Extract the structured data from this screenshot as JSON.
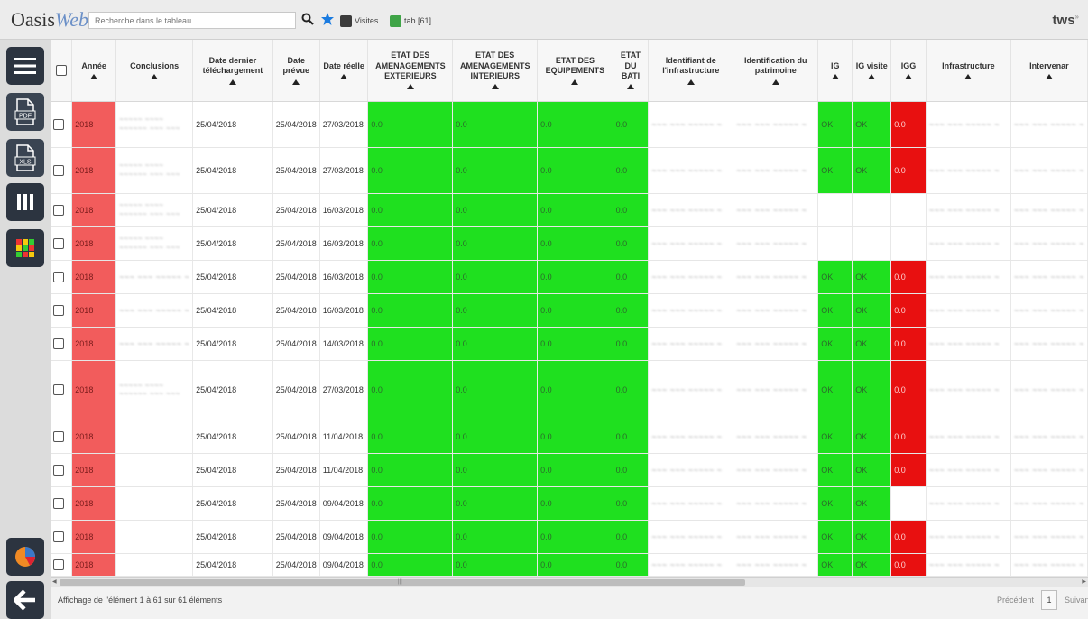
{
  "app": {
    "name_main": "Oasis",
    "name_accent": "Web",
    "user": "tws",
    "user_close": "»"
  },
  "search": {
    "placeholder": "Recherche dans le tableau..."
  },
  "toolbar": {
    "visits_label": "Visites",
    "tab_label": "tab [61]"
  },
  "colors": {
    "red": "#f25c5c",
    "green": "#1fe01f",
    "dark_red": "#e81010"
  },
  "table": {
    "headers": [
      {
        "key": "annee",
        "label": "Année"
      },
      {
        "key": "conclusions",
        "label": "Conclusions"
      },
      {
        "key": "date_dl",
        "label": "Date dernier téléchargement"
      },
      {
        "key": "date_prevue",
        "label": "Date prévue"
      },
      {
        "key": "date_reelle",
        "label": "Date réelle"
      },
      {
        "key": "etat_ext",
        "label": "ETAT DES AMENAGEMENTS EXTERIEURS"
      },
      {
        "key": "etat_int",
        "label": "ETAT DES AMENAGEMENTS INTERIEURS"
      },
      {
        "key": "etat_equip",
        "label": "ETAT DES EQUIPEMENTS"
      },
      {
        "key": "etat_bati",
        "label": "ETAT DU BATI"
      },
      {
        "key": "id_infra",
        "label": "Identifiant de l'infrastructure"
      },
      {
        "key": "id_patri",
        "label": "Identification du patrimoine"
      },
      {
        "key": "ig",
        "label": "IG"
      },
      {
        "key": "ig_visite",
        "label": "IG visite"
      },
      {
        "key": "igg",
        "label": "IGG"
      },
      {
        "key": "infra",
        "label": "Infrastructure"
      },
      {
        "key": "interv",
        "label": "Intervenar"
      }
    ],
    "rows": [
      {
        "annee": "2018",
        "date_dl": "25/04/2018",
        "date_prevue": "25/04/2018",
        "date_reelle": "27/03/2018",
        "etat_ext": "0.0",
        "etat_int": "0.0",
        "etat_equip": "0.0",
        "etat_bati": "0.0",
        "ig": "OK",
        "ig_visite": "OK",
        "igg": "0.0"
      },
      {
        "annee": "2018",
        "date_dl": "25/04/2018",
        "date_prevue": "25/04/2018",
        "date_reelle": "27/03/2018",
        "etat_ext": "0.0",
        "etat_int": "0.0",
        "etat_equip": "0.0",
        "etat_bati": "0.0",
        "ig": "OK",
        "ig_visite": "OK",
        "igg": "0.0"
      },
      {
        "annee": "2018",
        "date_dl": "25/04/2018",
        "date_prevue": "25/04/2018",
        "date_reelle": "16/03/2018",
        "etat_ext": "0.0",
        "etat_int": "0.0",
        "etat_equip": "0.0",
        "etat_bati": "0.0",
        "ig": "",
        "ig_visite": "",
        "igg": ""
      },
      {
        "annee": "2018",
        "date_dl": "25/04/2018",
        "date_prevue": "25/04/2018",
        "date_reelle": "16/03/2018",
        "etat_ext": "0.0",
        "etat_int": "0.0",
        "etat_equip": "0.0",
        "etat_bati": "0.0",
        "ig": "",
        "ig_visite": "",
        "igg": ""
      },
      {
        "annee": "2018",
        "date_dl": "25/04/2018",
        "date_prevue": "25/04/2018",
        "date_reelle": "16/03/2018",
        "etat_ext": "0.0",
        "etat_int": "0.0",
        "etat_equip": "0.0",
        "etat_bati": "0.0",
        "ig": "OK",
        "ig_visite": "OK",
        "igg": "0.0"
      },
      {
        "annee": "2018",
        "date_dl": "25/04/2018",
        "date_prevue": "25/04/2018",
        "date_reelle": "16/03/2018",
        "etat_ext": "0.0",
        "etat_int": "0.0",
        "etat_equip": "0.0",
        "etat_bati": "0.0",
        "ig": "OK",
        "ig_visite": "OK",
        "igg": "0.0"
      },
      {
        "annee": "2018",
        "date_dl": "25/04/2018",
        "date_prevue": "25/04/2018",
        "date_reelle": "14/03/2018",
        "etat_ext": "0.0",
        "etat_int": "0.0",
        "etat_equip": "0.0",
        "etat_bati": "0.0",
        "ig": "OK",
        "ig_visite": "OK",
        "igg": "0.0"
      },
      {
        "annee": "2018",
        "date_dl": "25/04/2018",
        "date_prevue": "25/04/2018",
        "date_reelle": "27/03/2018",
        "etat_ext": "0.0",
        "etat_int": "0.0",
        "etat_equip": "0.0",
        "etat_bati": "0.0",
        "ig": "OK",
        "ig_visite": "OK",
        "igg": "0.0"
      },
      {
        "annee": "2018",
        "date_dl": "25/04/2018",
        "date_prevue": "25/04/2018",
        "date_reelle": "11/04/2018",
        "etat_ext": "0.0",
        "etat_int": "0.0",
        "etat_equip": "0.0",
        "etat_bati": "0.0",
        "ig": "OK",
        "ig_visite": "OK",
        "igg": "0.0"
      },
      {
        "annee": "2018",
        "date_dl": "25/04/2018",
        "date_prevue": "25/04/2018",
        "date_reelle": "11/04/2018",
        "etat_ext": "0.0",
        "etat_int": "0.0",
        "etat_equip": "0.0",
        "etat_bati": "0.0",
        "ig": "OK",
        "ig_visite": "OK",
        "igg": "0.0"
      },
      {
        "annee": "2018",
        "date_dl": "25/04/2018",
        "date_prevue": "25/04/2018",
        "date_reelle": "09/04/2018",
        "etat_ext": "0.0",
        "etat_int": "0.0",
        "etat_equip": "0.0",
        "etat_bati": "0.0",
        "ig": "OK",
        "ig_visite": "OK",
        "igg": ""
      },
      {
        "annee": "2018",
        "date_dl": "25/04/2018",
        "date_prevue": "25/04/2018",
        "date_reelle": "09/04/2018",
        "etat_ext": "0.0",
        "etat_int": "0.0",
        "etat_equip": "0.0",
        "etat_bati": "0.0",
        "ig": "OK",
        "ig_visite": "OK",
        "igg": "0.0"
      },
      {
        "annee": "2018",
        "date_dl": "25/04/2018",
        "date_prevue": "25/04/2018",
        "date_reelle": "09/04/2018",
        "etat_ext": "0.0",
        "etat_int": "0.0",
        "etat_equip": "0.0",
        "etat_bati": "0.0",
        "ig": "OK",
        "ig_visite": "OK",
        "igg": "0.0"
      }
    ]
  },
  "footer": {
    "info": "Affichage de l'élément 1 à 61 sur 61 éléments",
    "prev_label": "Précédent",
    "page": "1",
    "next_label": "Suivant"
  }
}
